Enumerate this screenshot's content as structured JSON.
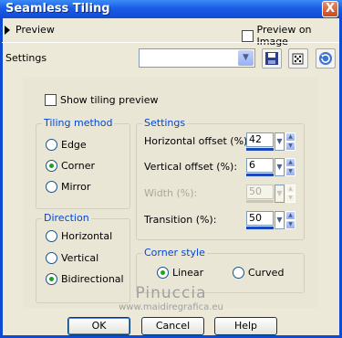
{
  "window": {
    "title": "Seamless Tiling",
    "close_glyph": "X"
  },
  "preview": {
    "label": "Preview",
    "preview_on_image_label": "Preview on Image",
    "preview_on_image_checked": false
  },
  "settings_row": {
    "label": "Settings",
    "preset_value": "",
    "icons": [
      "save-icon",
      "dice-icon",
      "reset-icon"
    ]
  },
  "show_tiling_preview": {
    "label": "Show tiling preview",
    "checked": false
  },
  "tiling_method": {
    "title": "Tiling method",
    "options": [
      {
        "label": "Edge",
        "selected": false
      },
      {
        "label": "Corner",
        "selected": true
      },
      {
        "label": "Mirror",
        "selected": false
      }
    ]
  },
  "direction": {
    "title": "Direction",
    "options": [
      {
        "label": "Horizontal",
        "selected": false
      },
      {
        "label": "Vertical",
        "selected": false
      },
      {
        "label": "Bidirectional",
        "selected": true
      }
    ]
  },
  "settings_group": {
    "title": "Settings",
    "fields": [
      {
        "label": "Horizontal offset (%):",
        "value": "42",
        "enabled": true
      },
      {
        "label": "Vertical offset (%):",
        "value": "6",
        "enabled": true
      },
      {
        "label": "Width (%):",
        "value": "50",
        "enabled": false
      },
      {
        "label": "Transition (%):",
        "value": "50",
        "enabled": true
      }
    ]
  },
  "corner_style": {
    "title": "Corner style",
    "options": [
      {
        "label": "Linear",
        "selected": true
      },
      {
        "label": "Curved",
        "selected": false
      }
    ]
  },
  "watermark": {
    "line1": "Pinuccia",
    "line2": "www.maidiregrafica.eu"
  },
  "buttons": {
    "ok": "OK",
    "cancel": "Cancel",
    "help": "Help"
  },
  "colors": {
    "titlebar": "#0f4ad4",
    "group_title": "#0046d5",
    "dialog_bg": "#ece9d8"
  }
}
